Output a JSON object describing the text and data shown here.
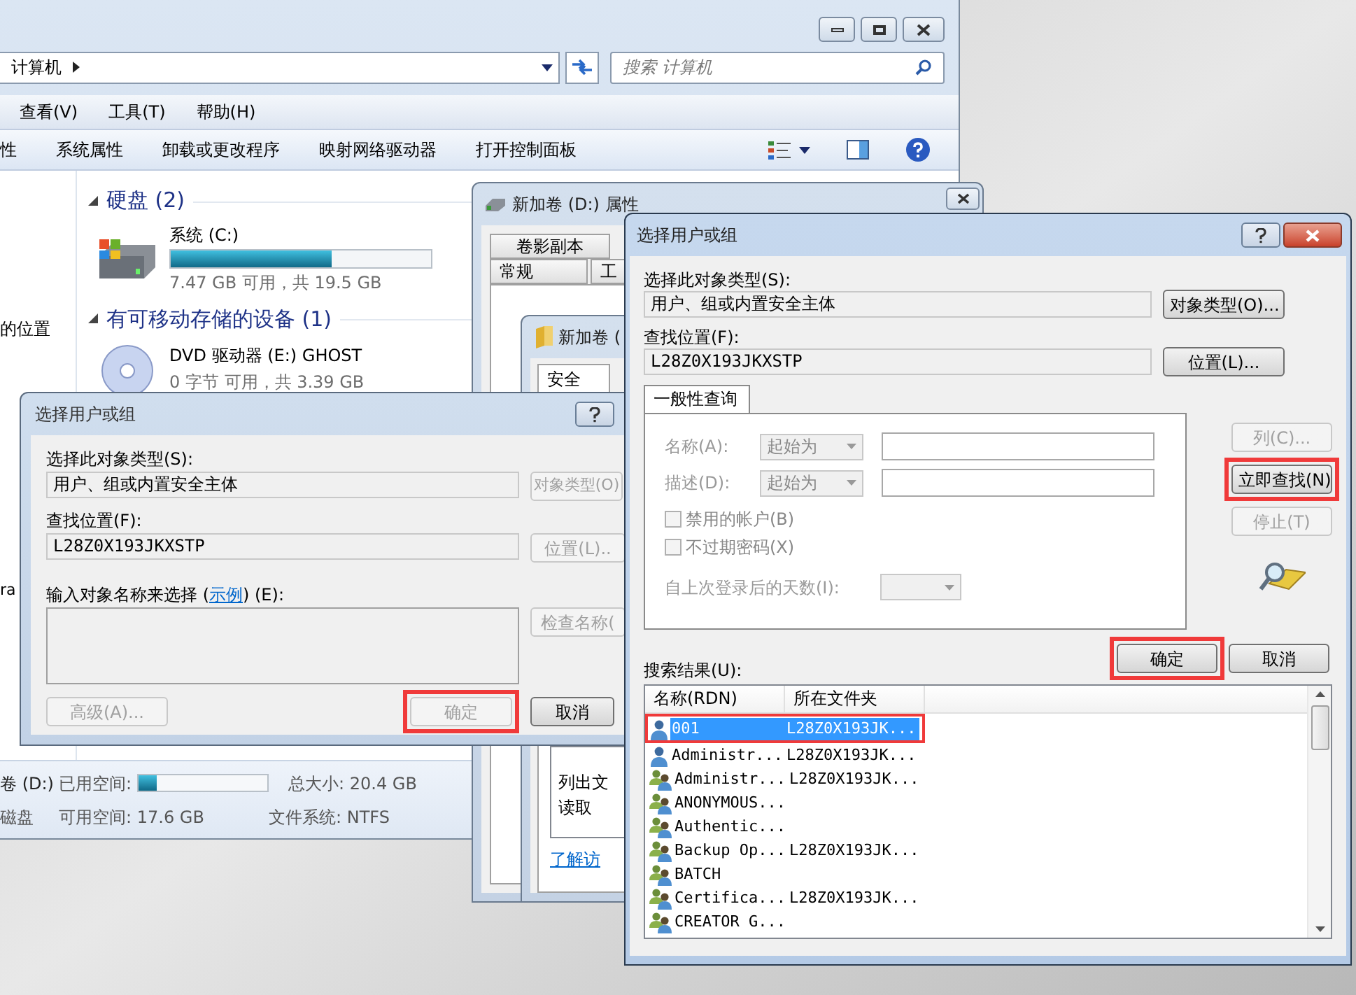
{
  "explorer": {
    "address": "计算机",
    "search": {
      "placeholder": "搜索 计算机"
    },
    "menu": [
      "查看(V)",
      "工具(T)",
      "帮助(H)"
    ],
    "toolbar": [
      "性",
      "系统属性",
      "卸载或更改程序",
      "映射网络驱动器",
      "打开控制面板"
    ],
    "nav": [
      "的位置",
      "ra"
    ],
    "groups": [
      {
        "title": "硬盘 (2)",
        "drives": [
          {
            "kind": "disk",
            "name": "系统 (C:)",
            "level": 0.62,
            "info": "7.47 GB 可用，共 19.5 GB"
          }
        ]
      },
      {
        "title": "有可移动存储的设备 (1)",
        "drives": [
          {
            "kind": "dvd",
            "name": "DVD 驱动器 (E:) GHOST",
            "info": "0 字节 可用，共 3.39 GB"
          }
        ]
      }
    ],
    "details": {
      "drive": "卷 (D:)",
      "type": "磁盘",
      "used_label": "已用空间:",
      "used_bar": {
        "level": 0.14
      },
      "total": "总大小: 20.4 GB",
      "free": "可用空间: 17.6 GB",
      "filesystem": "文件系统: NTFS"
    }
  },
  "properties_window": {
    "title": "新加卷 (D:) 属性",
    "tabs": [
      [
        "卷影副本"
      ],
      [
        "常规",
        "工"
      ]
    ]
  },
  "security_window": {
    "title": "新加卷 (",
    "tab": "安全",
    "list": [
      "列出文",
      "读取"
    ],
    "link": "了解访"
  },
  "left_dialog": {
    "title": "选择用户或组",
    "type_label": "选择此对象类型(S):",
    "type_value": "用户、组或内置安全主体",
    "type_button": {
      "label": "对象类型(O)",
      "disabled": true
    },
    "location_label": "查找位置(F):",
    "location_value": "L28Z0X193JKXSTP",
    "location_button": {
      "label": "位置(L)..",
      "disabled": true
    },
    "names_label_before": "输入对象名称来选择 (",
    "names_link": "示例",
    "names_label_after": ") (E):",
    "check_button": {
      "label": "检查名称(",
      "disabled": true
    },
    "advanced_button": {
      "label": "高级(A)...",
      "disabled": true
    },
    "ok_button": {
      "label": "确定",
      "disabled": true,
      "highlighted": true
    },
    "cancel_button": {
      "label": "取消",
      "disabled": false
    }
  },
  "right_dialog": {
    "title": "选择用户或组",
    "type_label": "选择此对象类型(S):",
    "type_value": "用户、组或内置安全主体",
    "type_button": {
      "label": "对象类型(O)...",
      "disabled": false
    },
    "location_label": "查找位置(F):",
    "location_value": "L28Z0X193JKXSTP",
    "location_button": {
      "label": "位置(L)...",
      "disabled": false
    },
    "query_tab": "一般性查询",
    "name_row": {
      "label": "名称(A):",
      "operator": "起始为"
    },
    "desc_row": {
      "label": "描述(D):",
      "operator": "起始为"
    },
    "checkboxes": [
      {
        "label": "禁用的帐户(B)",
        "checked": false
      },
      {
        "label": "不过期密码(X)",
        "checked": false
      }
    ],
    "days_label": "自上次登录后的天数(I):",
    "side_buttons": [
      {
        "label": "列(C)...",
        "disabled": true,
        "highlighted": false
      },
      {
        "label": "立即查找(N)",
        "disabled": false,
        "highlighted": true
      },
      {
        "label": "停止(T)",
        "disabled": true,
        "highlighted": false
      }
    ],
    "ok_button": {
      "label": "确定",
      "disabled": false,
      "highlighted": true
    },
    "cancel_button": {
      "label": "取消",
      "disabled": false
    },
    "results_label": "搜索结果(U):",
    "columns": [
      "名称(RDN)",
      "所在文件夹"
    ],
    "rows": [
      {
        "kind": "user",
        "name": "001",
        "folder": "L28Z0X193JK...",
        "selected": true,
        "highlighted": true
      },
      {
        "kind": "user",
        "name": "Administr...",
        "folder": "L28Z0X193JK...",
        "selected": false,
        "highlighted": false
      },
      {
        "kind": "group",
        "name": "Administr...",
        "folder": "L28Z0X193JK...",
        "selected": false,
        "highlighted": false
      },
      {
        "kind": "group",
        "name": "ANONYMOUS...",
        "selected": false,
        "highlighted": false
      },
      {
        "kind": "group",
        "name": "Authentic...",
        "selected": false,
        "highlighted": false
      },
      {
        "kind": "group",
        "name": "Backup Op...",
        "folder": "L28Z0X193JK...",
        "selected": false,
        "highlighted": false
      },
      {
        "kind": "group",
        "name": "BATCH",
        "selected": false,
        "highlighted": false
      },
      {
        "kind": "group",
        "name": "Certifica...",
        "folder": "L28Z0X193JK...",
        "selected": false,
        "highlighted": false
      },
      {
        "kind": "group",
        "name": "CREATOR G...",
        "selected": false,
        "highlighted": false
      }
    ]
  }
}
